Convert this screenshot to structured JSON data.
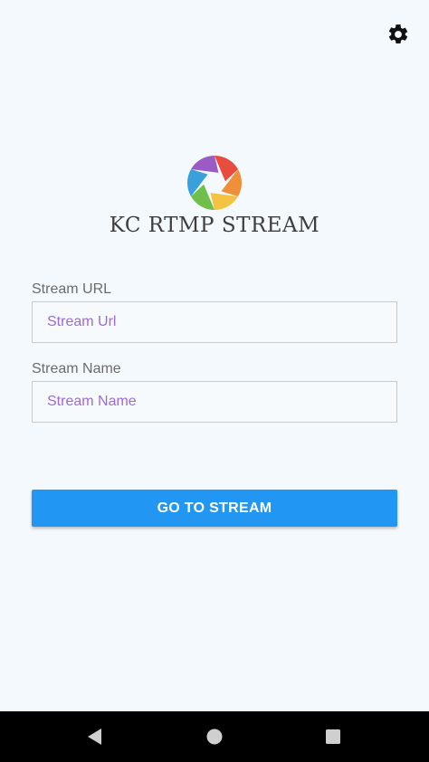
{
  "header": {
    "settings_icon": "gear-icon"
  },
  "brand": {
    "logo_icon": "camera-aperture-icon",
    "title": "KC RTMP STREAM",
    "logo_colors": [
      "#e74c3c",
      "#ef8f3a",
      "#f5c342",
      "#6fbf4a",
      "#3aa0dc",
      "#9b5bc4"
    ]
  },
  "form": {
    "stream_url": {
      "label": "Stream URL",
      "placeholder": "Stream Url",
      "value": ""
    },
    "stream_name": {
      "label": "Stream Name",
      "placeholder": "Stream Name",
      "value": ""
    }
  },
  "actions": {
    "go_label": "GO TO STREAM",
    "accent_color": "#2196f3"
  },
  "navbar": {
    "back_icon": "back-triangle-icon",
    "home_icon": "home-circle-icon",
    "recents_icon": "recents-square-icon"
  }
}
